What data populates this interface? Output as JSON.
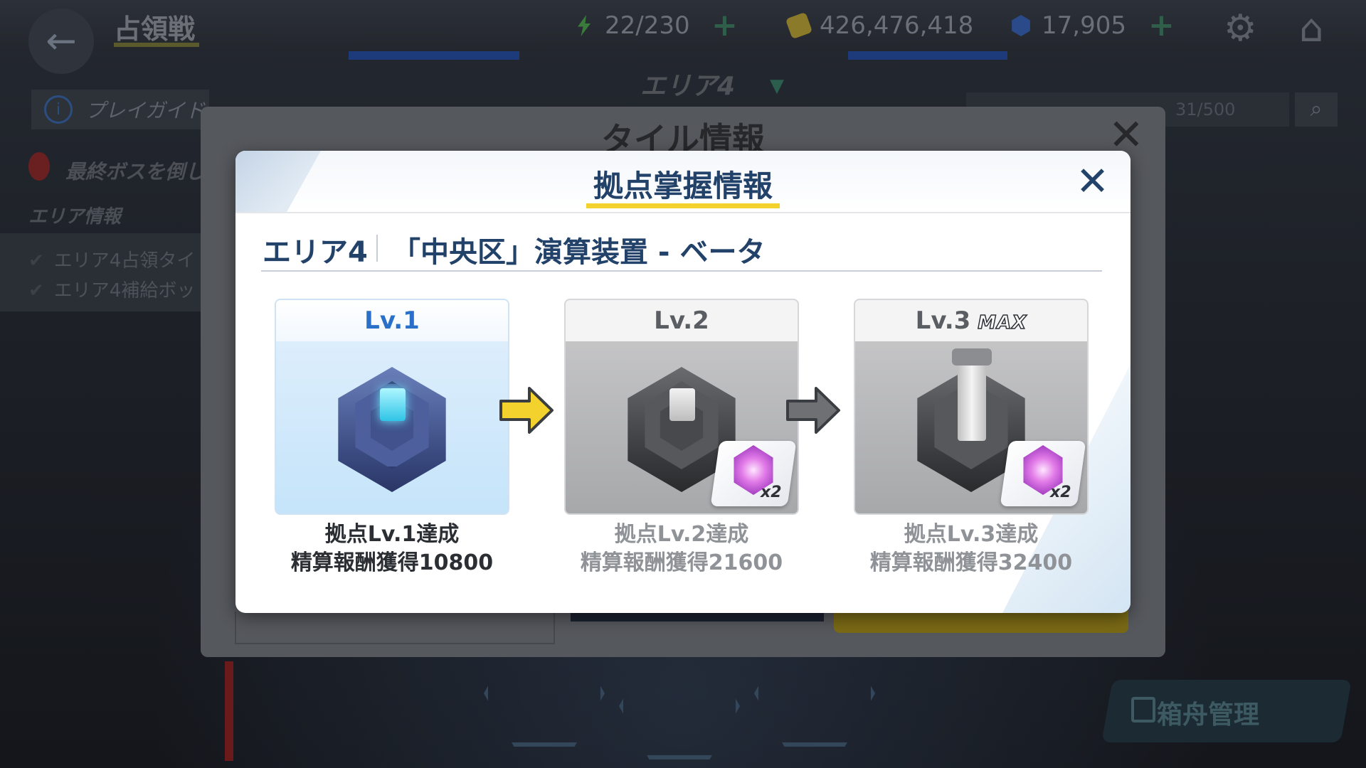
{
  "topbar": {
    "back_icon": "←",
    "title": "占領戦",
    "stamina": "22/230",
    "coins": "426,476,418",
    "crystals": "17,905",
    "plus": "+",
    "colors": {
      "stamina_icon": "#3a7a3a",
      "coin_icon": "#8a7a2a",
      "crystal_icon": "#2a4a8a"
    }
  },
  "background": {
    "area_label": "エリア4",
    "play_guide": "プレイガイド",
    "boss_text": "最終ボスを倒し",
    "area_info": "エリア情報",
    "left_items": [
      "エリア4占領タイ",
      "エリア4補給ボッ"
    ],
    "search_value": "31/500",
    "hangar_button": "箱舟管理"
  },
  "outer_modal": {
    "title": "タイル情報"
  },
  "inner_modal": {
    "title": "拠点掌握情報",
    "area_name": "エリア4",
    "tile_name": "「中央区」演算装置 - ベータ",
    "levels": [
      {
        "label": "Lv.1",
        "line1": "拠点Lv.1達成",
        "line2": "精算報酬獲得10800"
      },
      {
        "label": "Lv.2",
        "line1": "拠点Lv.2達成",
        "line2": "精算報酬獲得21600",
        "reward_count": "x2"
      },
      {
        "label": "Lv.3",
        "max_badge": "MAX",
        "line1": "拠点Lv.3達成",
        "line2": "精算報酬獲得32400",
        "reward_count": "x2"
      }
    ],
    "colors": {
      "title": "#23426a",
      "underline": "#f4d22e",
      "arrow_yellow": "#f4d22e",
      "arrow_gray": "#6e7074"
    }
  }
}
